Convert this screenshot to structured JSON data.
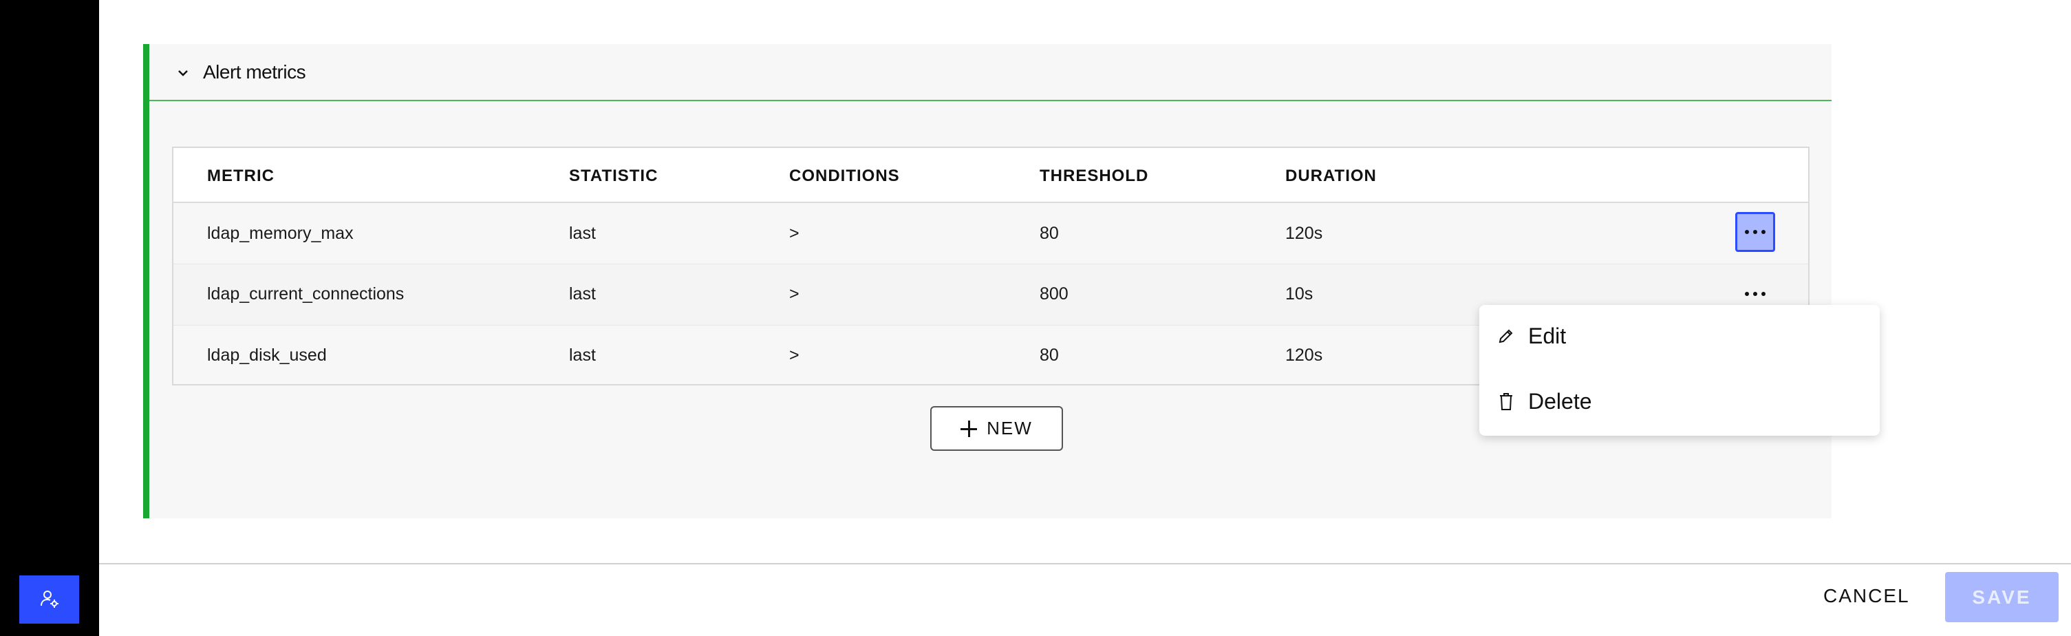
{
  "panel": {
    "title": "Alert metrics",
    "accent_color": "#1aa832"
  },
  "table": {
    "columns": [
      "METRIC",
      "STATISTIC",
      "CONDITIONS",
      "THRESHOLD",
      "DURATION"
    ],
    "rows": [
      {
        "metric": "ldap_memory_max",
        "statistic": "last",
        "conditions": ">",
        "threshold": "80",
        "duration": "120s"
      },
      {
        "metric": "ldap_current_connections",
        "statistic": "last",
        "conditions": ">",
        "threshold": "800",
        "duration": "10s"
      },
      {
        "metric": "ldap_disk_used",
        "statistic": "last",
        "conditions": ">",
        "threshold": "80",
        "duration": "120s"
      }
    ]
  },
  "context_menu": {
    "items": [
      {
        "label": "Edit",
        "icon": "pencil-icon"
      },
      {
        "label": "Delete",
        "icon": "trash-icon"
      }
    ]
  },
  "new_button": {
    "label": "NEW",
    "icon": "plus-icon"
  },
  "footer": {
    "cancel_label": "CANCEL",
    "save_label": "SAVE"
  },
  "sidebar": {
    "button_icon": "user-settings-icon",
    "accent_color": "#2b4dff"
  }
}
